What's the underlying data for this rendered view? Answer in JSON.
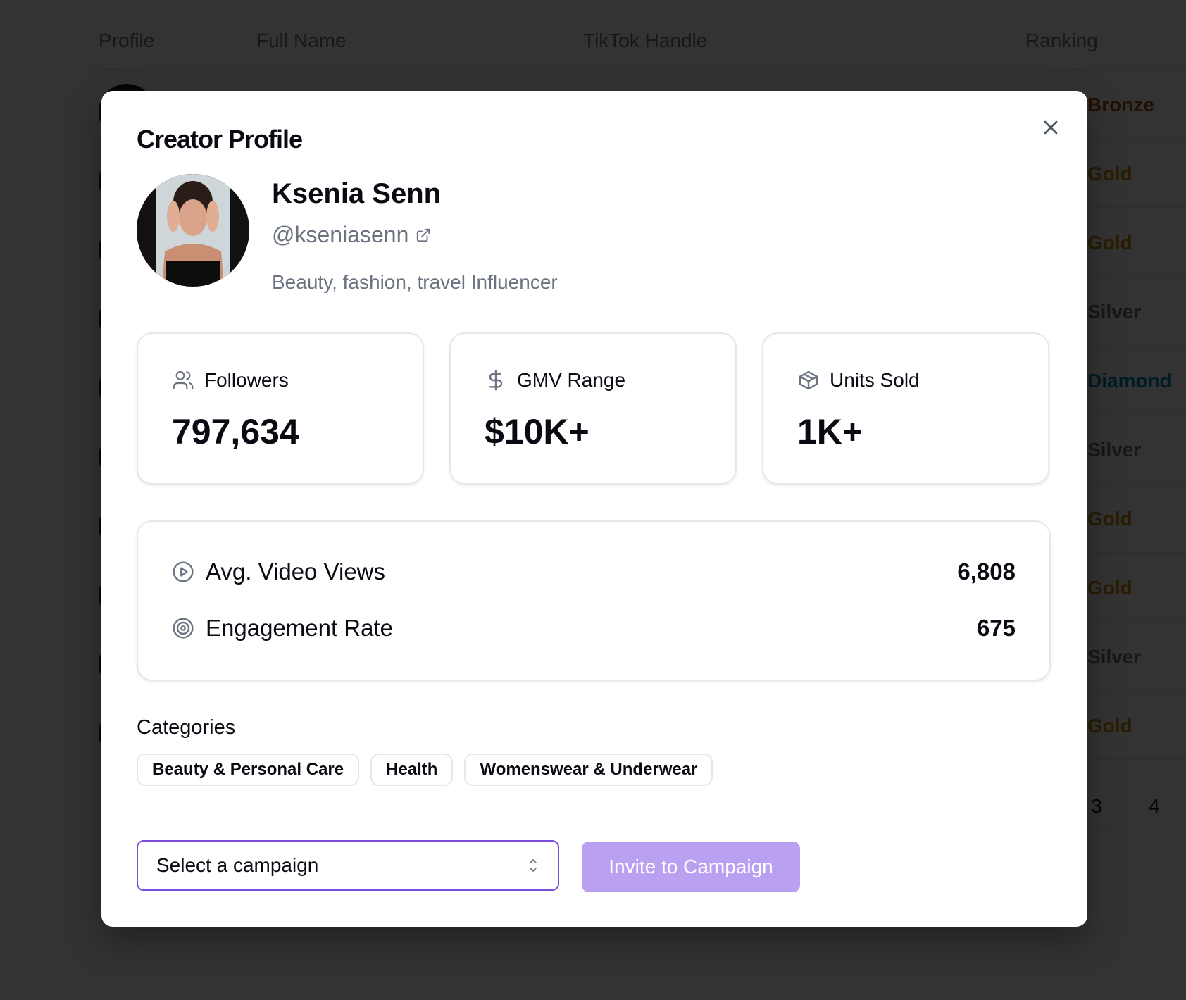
{
  "background": {
    "table_headers": [
      "Profile",
      "Full Name",
      "TikTok Handle",
      "Ranking"
    ],
    "rankings": [
      {
        "label": "Bronze",
        "color": "#b45309"
      },
      {
        "label": "Gold",
        "color": "#ca8a04"
      },
      {
        "label": "Gold",
        "color": "#ca8a04"
      },
      {
        "label": "Silver",
        "color": "#6b7280"
      },
      {
        "label": "Diamond",
        "color": "#0891b2"
      },
      {
        "label": "Silver",
        "color": "#6b7280"
      },
      {
        "label": "Gold",
        "color": "#ca8a04"
      },
      {
        "label": "Gold",
        "color": "#ca8a04"
      },
      {
        "label": "Silver",
        "color": "#6b7280"
      },
      {
        "label": "Gold",
        "color": "#ca8a04"
      }
    ],
    "pagination": [
      "3",
      "4"
    ]
  },
  "modal": {
    "title": "Creator Profile",
    "creator": {
      "name": "Ksenia Senn",
      "handle": "@kseniasenn",
      "bio": "Beauty, fashion, travel Influencer"
    },
    "cards": [
      {
        "icon": "users-icon",
        "label": "Followers",
        "value": "797,634"
      },
      {
        "icon": "dollar-icon",
        "label": "GMV Range",
        "value": "$10K+"
      },
      {
        "icon": "package-icon",
        "label": "Units Sold",
        "value": "1K+"
      }
    ],
    "stats": [
      {
        "icon": "play-circle-icon",
        "label": "Avg. Video Views",
        "value": "6,808"
      },
      {
        "icon": "target-icon",
        "label": "Engagement Rate",
        "value": "675"
      }
    ],
    "categories_title": "Categories",
    "categories": [
      "Beauty & Personal Care",
      "Health",
      "Womenswear & Underwear"
    ],
    "campaign_select": {
      "placeholder": "Select a campaign"
    },
    "invite_button": "Invite to Campaign",
    "accent_color": "#7c4ddb"
  }
}
